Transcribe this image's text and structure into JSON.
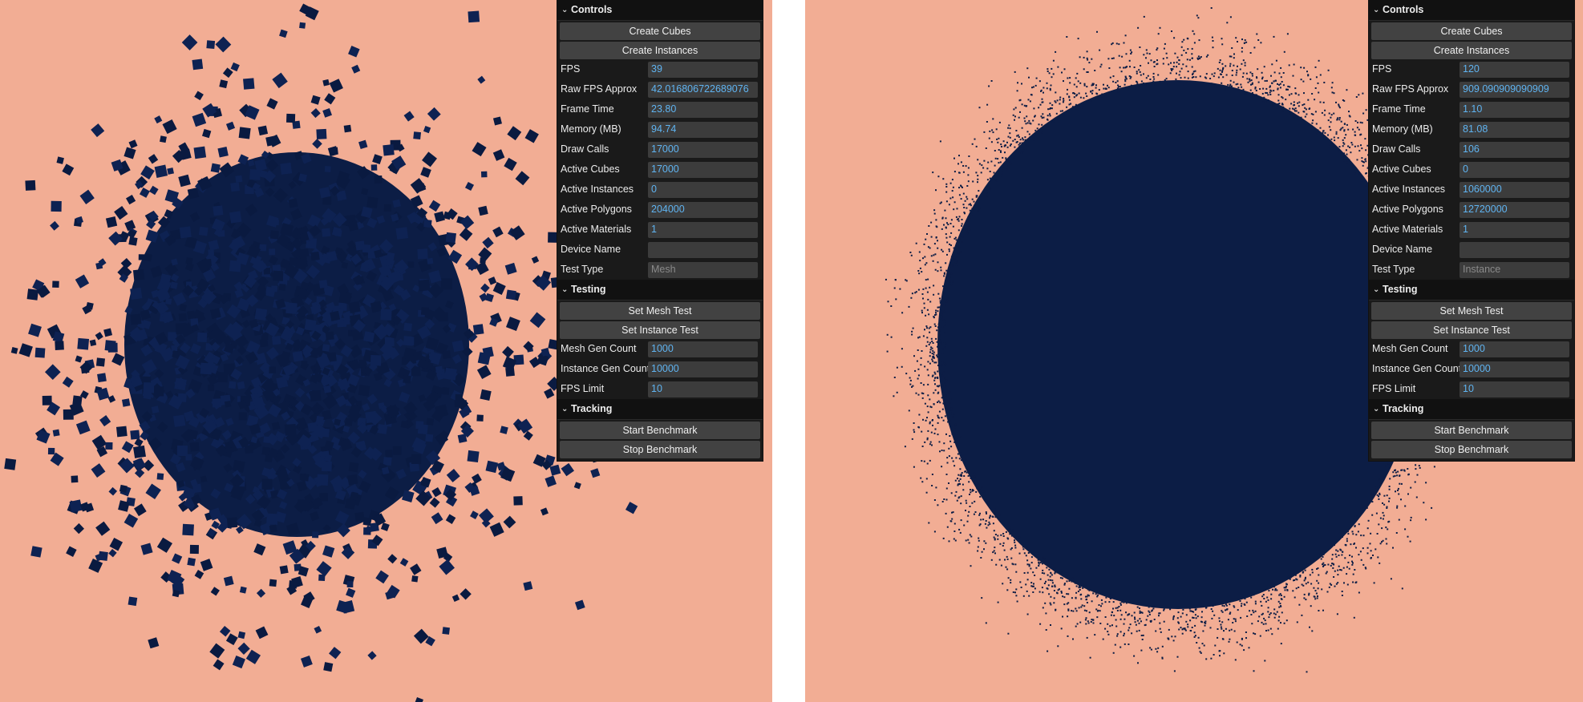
{
  "colors": {
    "background": "#f2ad94",
    "particle": "#0c1d45",
    "panel": "#1a1a1a",
    "field": "#3c3c3c",
    "value_text": "#5fb3f0"
  },
  "panels": [
    {
      "controls": {
        "title": "Controls",
        "buttons": [
          "Create Cubes",
          "Create Instances"
        ],
        "fields": [
          {
            "label": "FPS",
            "value": "39"
          },
          {
            "label": "Raw FPS Approx",
            "value": "42.016806722689076"
          },
          {
            "label": "Frame Time",
            "value": "23.80"
          },
          {
            "label": "Memory (MB)",
            "value": "94.74"
          },
          {
            "label": "Draw Calls",
            "value": "17000"
          },
          {
            "label": "Active Cubes",
            "value": "17000"
          },
          {
            "label": "Active Instances",
            "value": "0"
          },
          {
            "label": "Active Polygons",
            "value": "204000"
          },
          {
            "label": "Active Materials",
            "value": "1"
          },
          {
            "label": "Device Name",
            "value": ""
          },
          {
            "label": "Test Type",
            "value": "Mesh"
          }
        ]
      },
      "testing": {
        "title": "Testing",
        "buttons": [
          "Set Mesh Test",
          "Set Instance Test"
        ],
        "fields": [
          {
            "label": "Mesh Gen Count",
            "value": "1000"
          },
          {
            "label": "Instance Gen Count",
            "value": "10000"
          },
          {
            "label": "FPS Limit",
            "value": "10"
          }
        ]
      },
      "tracking": {
        "title": "Tracking",
        "buttons": [
          "Start Benchmark",
          "Stop Benchmark"
        ]
      }
    },
    {
      "controls": {
        "title": "Controls",
        "buttons": [
          "Create Cubes",
          "Create Instances"
        ],
        "fields": [
          {
            "label": "FPS",
            "value": "120"
          },
          {
            "label": "Raw FPS Approx",
            "value": "909.090909090909"
          },
          {
            "label": "Frame Time",
            "value": "1.10"
          },
          {
            "label": "Memory (MB)",
            "value": "81.08"
          },
          {
            "label": "Draw Calls",
            "value": "106"
          },
          {
            "label": "Active Cubes",
            "value": "0"
          },
          {
            "label": "Active Instances",
            "value": "1060000"
          },
          {
            "label": "Active Polygons",
            "value": "12720000"
          },
          {
            "label": "Active Materials",
            "value": "1"
          },
          {
            "label": "Device Name",
            "value": ""
          },
          {
            "label": "Test Type",
            "value": "Instance"
          }
        ]
      },
      "testing": {
        "title": "Testing",
        "buttons": [
          "Set Mesh Test",
          "Set Instance Test"
        ],
        "fields": [
          {
            "label": "Mesh Gen Count",
            "value": "1000"
          },
          {
            "label": "Instance Gen Count",
            "value": "10000"
          },
          {
            "label": "FPS Limit",
            "value": "10"
          }
        ]
      },
      "tracking": {
        "title": "Tracking",
        "buttons": [
          "Start Benchmark",
          "Stop Benchmark"
        ]
      }
    }
  ]
}
